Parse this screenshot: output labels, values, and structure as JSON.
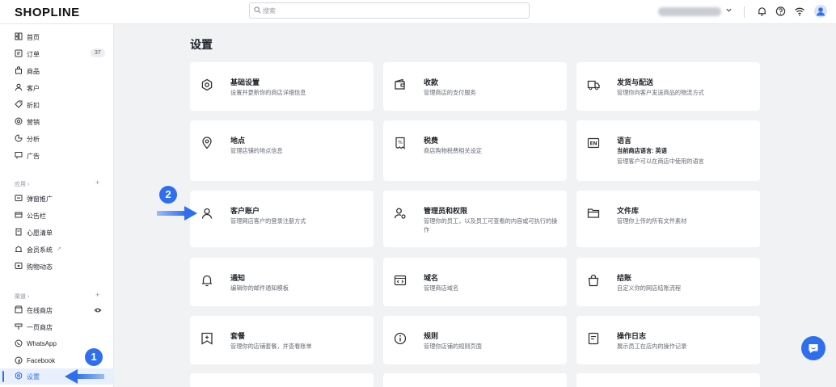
{
  "header": {
    "logo": "SHOPLINE",
    "search_placeholder": "搜索"
  },
  "sidebar": {
    "main_items": [
      {
        "label": "首页",
        "icon": "home-icon"
      },
      {
        "label": "订单",
        "icon": "order-icon",
        "badge": "37"
      },
      {
        "label": "商品",
        "icon": "product-icon"
      },
      {
        "label": "客户",
        "icon": "customer-icon"
      },
      {
        "label": "折扣",
        "icon": "discount-icon"
      },
      {
        "label": "营销",
        "icon": "marketing-icon"
      },
      {
        "label": "分析",
        "icon": "analytics-icon"
      },
      {
        "label": "广告",
        "icon": "ads-icon"
      }
    ],
    "apps_header": "应用 ›",
    "app_items": [
      {
        "label": "弹窗推广"
      },
      {
        "label": "公告栏"
      },
      {
        "label": "心愿清单"
      },
      {
        "label": "会员系统",
        "ext": "↗"
      },
      {
        "label": "购物动态"
      }
    ],
    "channels_header": "渠道 ›",
    "channel_items": [
      {
        "label": "在线商店"
      },
      {
        "label": "一页商店"
      },
      {
        "label": "WhatsApp"
      },
      {
        "label": "Facebook"
      }
    ],
    "settings_label": "设置"
  },
  "main": {
    "title": "设置",
    "cards": [
      {
        "title": "基础设置",
        "desc": "设置并更新你的商店详细信息"
      },
      {
        "title": "收款",
        "desc": "管理商店的支付服务"
      },
      {
        "title": "发货与配送",
        "desc": "管理你向客户发送商品的物流方式"
      },
      {
        "title": "地点",
        "desc": "管理店铺的地点信息"
      },
      {
        "title": "税费",
        "desc": "商店购物税费相关设定"
      },
      {
        "title": "语言",
        "desc": "当前商店语言: 英语",
        "desc2": "管理客户可以在商店中使用的语言"
      },
      {
        "title": "客户账户",
        "desc": "管理网店客户的登录注册方式"
      },
      {
        "title": "管理员和权限",
        "desc": "管理你的员工，以及员工可查看的内容或可执行的操作"
      },
      {
        "title": "文件库",
        "desc": "管理你上传的所有文件素材"
      },
      {
        "title": "通知",
        "desc": "编辑你的邮件通知模板"
      },
      {
        "title": "域名",
        "desc": "管理商店域名"
      },
      {
        "title": "结账",
        "desc": "自定义你的网店结账流程"
      },
      {
        "title": "套餐",
        "desc": "管理你的店铺套餐，并查看账单"
      },
      {
        "title": "规则",
        "desc": "管理你店铺的规则页面"
      },
      {
        "title": "操作日志",
        "desc": "展示员工在店内的操作记录"
      }
    ]
  },
  "annotations": {
    "step1": "1",
    "step2": "2"
  },
  "colors": {
    "accent": "#2f6fed",
    "background": "#f1f2f4"
  }
}
